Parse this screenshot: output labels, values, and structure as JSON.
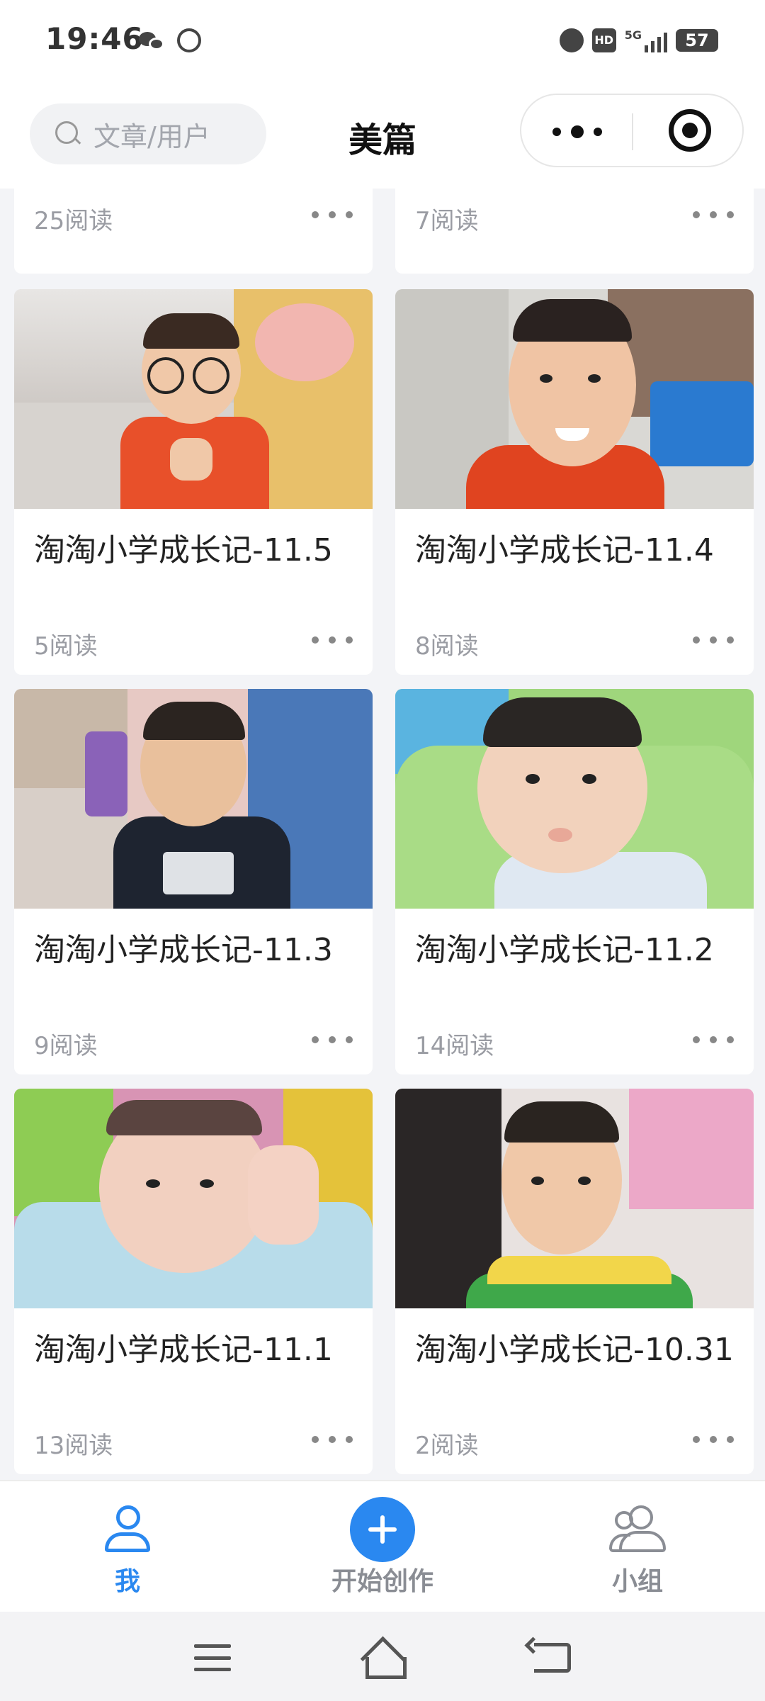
{
  "status_bar": {
    "time": "19:46",
    "left_icons": [
      "wechat-icon",
      "vpn-icon"
    ],
    "right_icons": [
      "alarm-icon",
      "hd-icon",
      "signal-5g-icon"
    ],
    "network": "5G",
    "battery": "57"
  },
  "header": {
    "search_placeholder": "文章/用户",
    "title": "美篇",
    "capsule_icons": [
      "more-icon",
      "target-icon"
    ]
  },
  "feed": {
    "partial_cards": [
      {
        "reads": "25阅读"
      },
      {
        "reads": "7阅读"
      }
    ],
    "cards": [
      {
        "title": "淘淘小学成长记-11.5",
        "reads": "5阅读"
      },
      {
        "title": "淘淘小学成长记-11.4",
        "reads": "8阅读"
      },
      {
        "title": "淘淘小学成长记-11.3",
        "reads": "9阅读"
      },
      {
        "title": "淘淘小学成长记-11.2",
        "reads": "14阅读"
      },
      {
        "title": "淘淘小学成长记-11.1",
        "reads": "13阅读"
      },
      {
        "title": "淘淘小学成长记-10.31",
        "reads": "2阅读"
      }
    ]
  },
  "tabbar": {
    "tabs": [
      {
        "label": "我",
        "icon": "user-icon",
        "active": true
      },
      {
        "label": "开始创作",
        "icon": "plus-icon",
        "active": false
      },
      {
        "label": "小组",
        "icon": "group-icon",
        "active": false
      }
    ]
  },
  "colors": {
    "accent": "#2a88f0",
    "background": "#f3f4f7",
    "muted_text": "#9a9ca3"
  }
}
